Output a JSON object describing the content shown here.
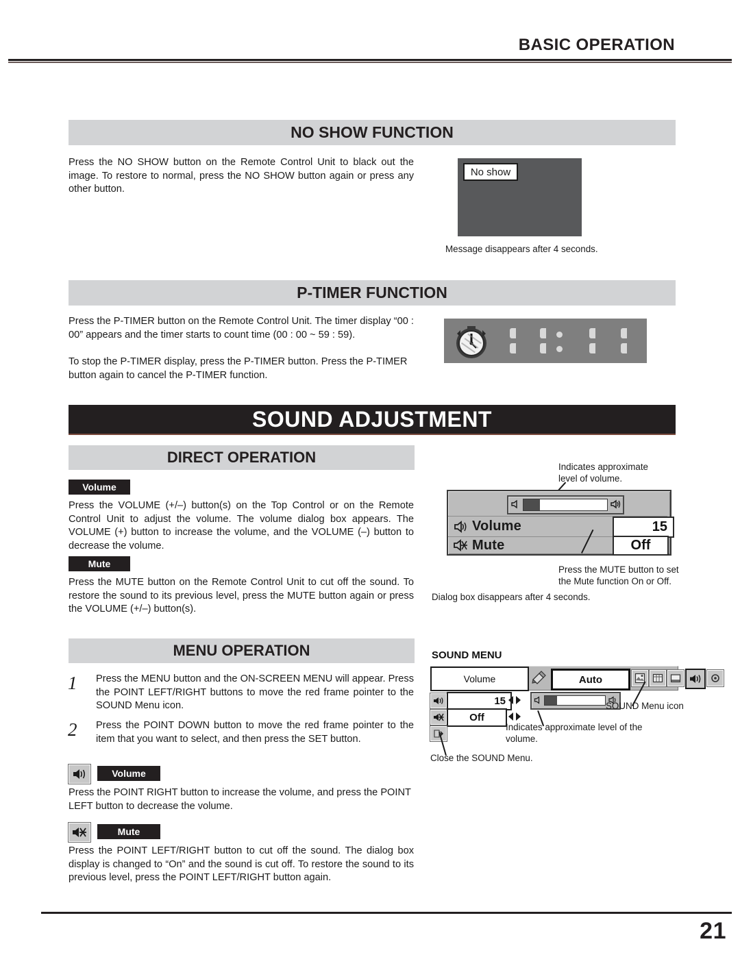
{
  "running_head": "BASIC OPERATION",
  "page_number": "21",
  "sections": {
    "no_show": {
      "title": "NO SHOW FUNCTION",
      "body": "Press the NO SHOW button on the Remote Control Unit to black out the image.  To restore to normal, press the NO SHOW button again or press any other button.",
      "screen_label": "No show",
      "caption": "Message disappears after 4 seconds."
    },
    "p_timer": {
      "title": "P-TIMER FUNCTION",
      "body_1": "Press the P-TIMER button on the Remote Control Unit.  The timer display “00 : 00” appears and the timer starts to count time (00 : 00 ~ 59 : 59).",
      "body_2": "To stop the P-TIMER display, press the P-TIMER button.  Press the P-TIMER button again to cancel the P-TIMER function.",
      "timer_display": "00 : 00"
    },
    "sound_adjustment": {
      "title": "SOUND ADJUSTMENT",
      "direct_operation": {
        "title": "DIRECT OPERATION",
        "volume_tag": "Volume",
        "volume_body": "Press the VOLUME (+/–) button(s) on the Top Control or on the Remote Control Unit to adjust the volume.  The volume dialog box appears.  The VOLUME (+) button to increase the volume, and the VOLUME (–) button to decrease the volume.",
        "mute_tag": "Mute",
        "mute_body": "Press the MUTE button on the Remote Control Unit to cut off the sound.  To restore the sound to its previous level, press the MUTE button again or press the VOLUME (+/–) button(s)."
      },
      "dialog": {
        "callout_top": "Indicates approximate\nlevel of volume.",
        "volume_label": "Volume",
        "volume_value": "15",
        "mute_label": "Mute",
        "mute_value": "Off",
        "callout_bottom": "Press the MUTE button to set\nthe Mute function On or Off.",
        "caption": "Dialog box disappears after 4 seconds.",
        "slider_percent": 20
      },
      "menu_operation": {
        "title": "MENU OPERATION",
        "steps": [
          {
            "num": "1",
            "text": "Press the MENU button and the ON-SCREEN MENU will appear.  Press the POINT LEFT/RIGHT buttons to move the red frame pointer to the SOUND Menu icon."
          },
          {
            "num": "2",
            "text": "Press the POINT DOWN button to move the red frame pointer to the item that you want to select, and then press the SET button."
          }
        ],
        "volume_tag": "Volume",
        "volume_body": "Press the POINT RIGHT button to increase the volume, and press the POINT LEFT button to decrease the volume.",
        "mute_tag": "Mute",
        "mute_body": "Press the POINT LEFT/RIGHT button to cut off the sound.  The dialog box display is changed to “On” and the sound is cut off.  To restore the sound to its previous level, press the POINT LEFT/RIGHT button again."
      },
      "sound_menu": {
        "title": "SOUND MENU",
        "title_box": "Volume",
        "auto_box": "Auto",
        "volume_value": "15",
        "mute_value": "Off",
        "callout_icon": "SOUND Menu icon",
        "callout_level": "Indicates approximate level of the\nvolume.",
        "callout_close": "Close the SOUND Menu.",
        "slider_percent": 20
      }
    }
  },
  "colors": {
    "header_gray": "#d2d3d5",
    "header_black": "#231f20",
    "screen_gray": "#58595b",
    "dialog_gray": "#bcbcbc",
    "menu_gray": "#b9b9b9"
  }
}
